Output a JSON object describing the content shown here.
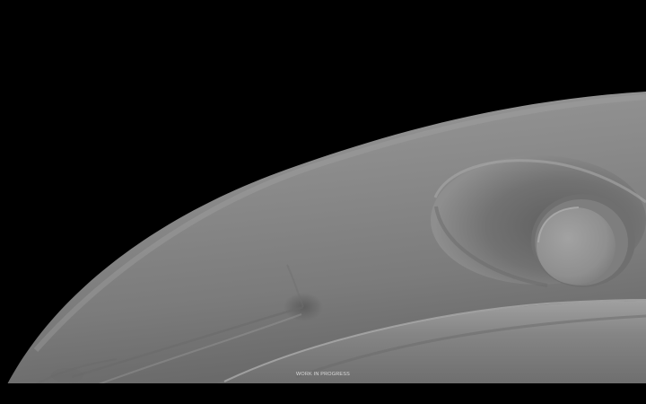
{
  "scene": {
    "caption": "WORK IN PROGRESS",
    "background_color": "#000000",
    "model_color": "#8a8a8a",
    "shape_icon": "clay-render-closeup"
  }
}
